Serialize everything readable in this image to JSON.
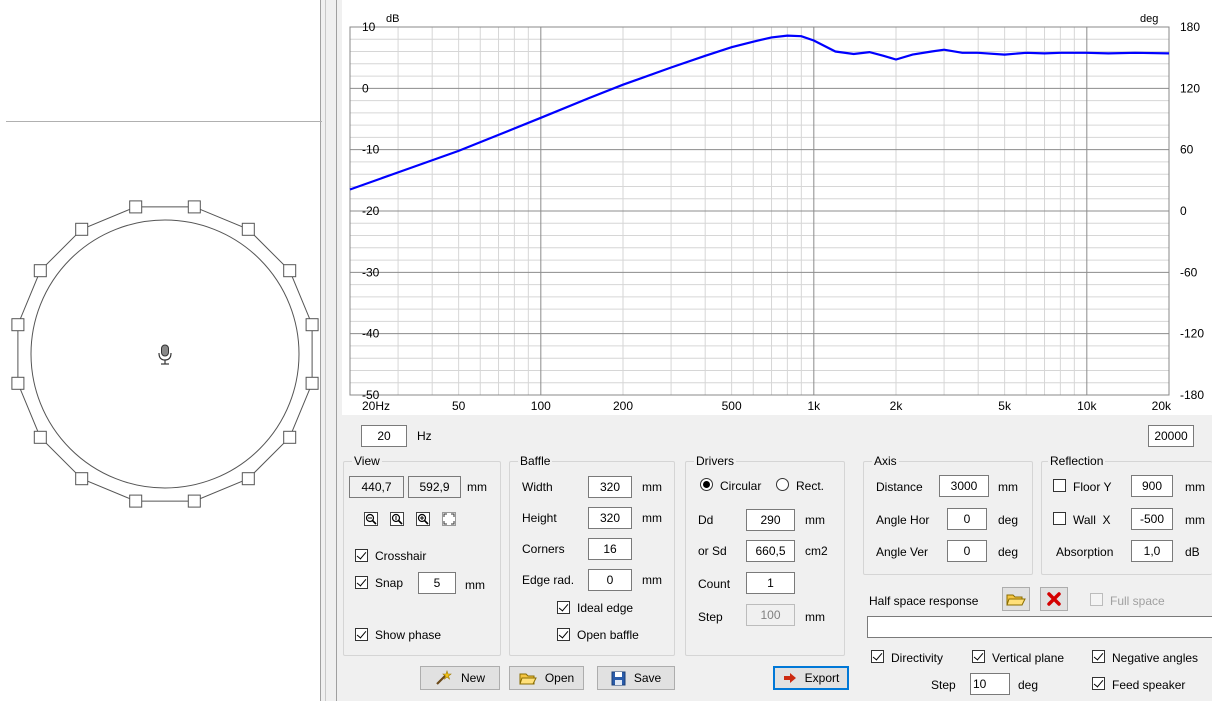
{
  "chart_data": {
    "type": "line",
    "xscale": "log",
    "xlim": [
      20,
      20000
    ],
    "ylim": [
      -50,
      10
    ],
    "y2lim": [
      -180,
      180
    ],
    "grid": true,
    "ylabel": "dB",
    "y2label": "deg",
    "y_ticks": [
      "10",
      "0",
      "-10",
      "-20",
      "-30",
      "-40",
      "-50"
    ],
    "y2_ticks": [
      "180",
      "120",
      "60",
      "0",
      "-60",
      "-120",
      "-180"
    ],
    "x_ticks": [
      {
        "v": 20,
        "label": "20Hz"
      },
      {
        "v": 50,
        "label": "50"
      },
      {
        "v": 100,
        "label": "100"
      },
      {
        "v": 200,
        "label": "200"
      },
      {
        "v": 500,
        "label": "500"
      },
      {
        "v": 1000,
        "label": "1k"
      },
      {
        "v": 2000,
        "label": "2k"
      },
      {
        "v": 5000,
        "label": "5k"
      },
      {
        "v": 10000,
        "label": "10k"
      },
      {
        "v": 20000,
        "label": "20k"
      }
    ],
    "series": [
      {
        "color": "#0000ff",
        "x": [
          20,
          30,
          50,
          70,
          100,
          150,
          200,
          300,
          400,
          500,
          600,
          700,
          800,
          900,
          1000,
          1200,
          1400,
          1600,
          1800,
          2000,
          2300,
          2700,
          3000,
          3500,
          4000,
          5000,
          6000,
          7000,
          8000,
          10000,
          12000,
          15000,
          20000
        ],
        "y": [
          -16.5,
          -13.7,
          -10.2,
          -7.6,
          -4.8,
          -1.6,
          0.6,
          3.4,
          5.3,
          6.7,
          7.6,
          8.3,
          8.6,
          8.5,
          7.8,
          6.0,
          5.6,
          5.9,
          5.3,
          4.7,
          5.5,
          6.0,
          6.3,
          5.8,
          5.8,
          5.5,
          5.8,
          5.7,
          5.8,
          5.8,
          5.7,
          5.8,
          5.7
        ]
      }
    ]
  },
  "axis_inputs": {
    "fmin": "20",
    "fmin_unit": "Hz",
    "fmax": "20000"
  },
  "view": {
    "title": "View",
    "x": "440,7",
    "y": "592,9",
    "unit": "mm",
    "crosshair_label": "Crosshair",
    "crosshair_checked": true,
    "snap_label": "Snap",
    "snap_checked": true,
    "snap_value": "5",
    "snap_unit": "mm",
    "show_phase_label": "Show phase",
    "show_phase_checked": true
  },
  "baffle": {
    "title": "Baffle",
    "width_label": "Width",
    "width": "320",
    "height_label": "Height",
    "height": "320",
    "corners_label": "Corners",
    "corners": "16",
    "edge_label": "Edge rad.",
    "edge": "0",
    "unit": "mm",
    "ideal_edge_label": "Ideal edge",
    "ideal_edge_checked": true,
    "open_baffle_label": "Open baffle",
    "open_baffle_checked": true
  },
  "drivers": {
    "title": "Drivers",
    "circular_label": "Circular",
    "rect_label": "Rect.",
    "selected": "circular",
    "dd_label": "Dd",
    "dd": "290",
    "dd_unit": "mm",
    "sd_label": "or Sd",
    "sd": "660,5",
    "sd_unit": "cm2",
    "count_label": "Count",
    "count": "1",
    "step_label": "Step",
    "step": "100",
    "step_unit": "mm"
  },
  "axis": {
    "title": "Axis",
    "distance_label": "Distance",
    "distance": "3000",
    "distance_unit": "mm",
    "hor_label": "Angle Hor",
    "hor": "0",
    "ver_label": "Angle Ver",
    "ver": "0",
    "angle_unit": "deg"
  },
  "reflection": {
    "title": "Reflection",
    "floor_label": "Floor Y",
    "floor": "900",
    "floor_checked": false,
    "wall_label": "Wall  X",
    "wall": "-500",
    "wall_checked": false,
    "unit": "mm",
    "absorption_label": "Absorption",
    "absorption": "1,0",
    "absorption_unit": "dB"
  },
  "half_space": {
    "label": "Half space response",
    "full_space_label": "Full space",
    "full_space_checked": false,
    "file_value": ""
  },
  "options": {
    "directivity_label": "Directivity",
    "directivity_checked": true,
    "vertical_plane_label": "Vertical plane",
    "vertical_plane_checked": true,
    "negative_angles_label": "Negative angles",
    "negative_angles_checked": true,
    "step_label": "Step",
    "step": "10",
    "step_unit": "deg",
    "feed_speaker_label": "Feed speaker",
    "feed_speaker_checked": true
  },
  "buttons": {
    "new": "New",
    "open": "Open",
    "save": "Save",
    "export": "Export"
  },
  "icons": {
    "zoom_out": "zoom-out-icon",
    "zoom_fit": "zoom-fit-icon",
    "zoom_in": "zoom-in-icon",
    "zoom_full": "zoom-full-icon",
    "microphone": "microphone-icon",
    "open_folder": "open-folder-icon",
    "delete": "delete-icon"
  },
  "colors": {
    "curve": "#0000ff",
    "delete": "#d40000",
    "focus": "#0078d7"
  }
}
